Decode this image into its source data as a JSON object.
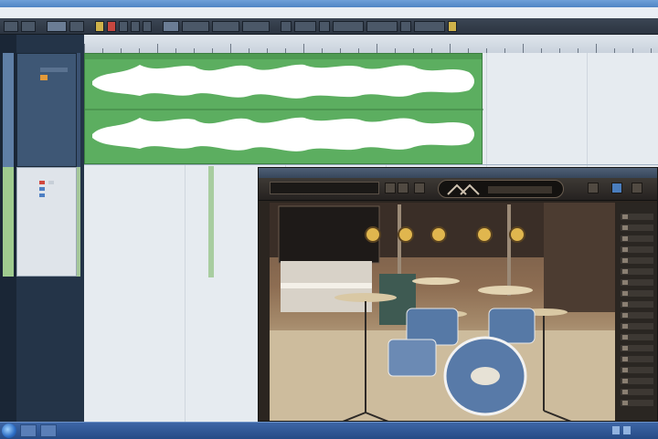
{
  "window": {
    "title": ""
  },
  "menu": {
    "items": []
  },
  "track1": {
    "name": ""
  },
  "track2": {
    "name": ""
  },
  "plugin": {
    "title": "",
    "preset": "",
    "knobs": [
      "",
      "",
      "",
      "",
      ""
    ]
  },
  "taskbar": {
    "clock": ""
  },
  "colors": {
    "audio_event": "#5cae60",
    "waveform": "#ffffff",
    "taskbar": "#2f5896"
  },
  "icons": [
    "start-orb-icon",
    "close-icon",
    "record-icon",
    "play-icon"
  ]
}
